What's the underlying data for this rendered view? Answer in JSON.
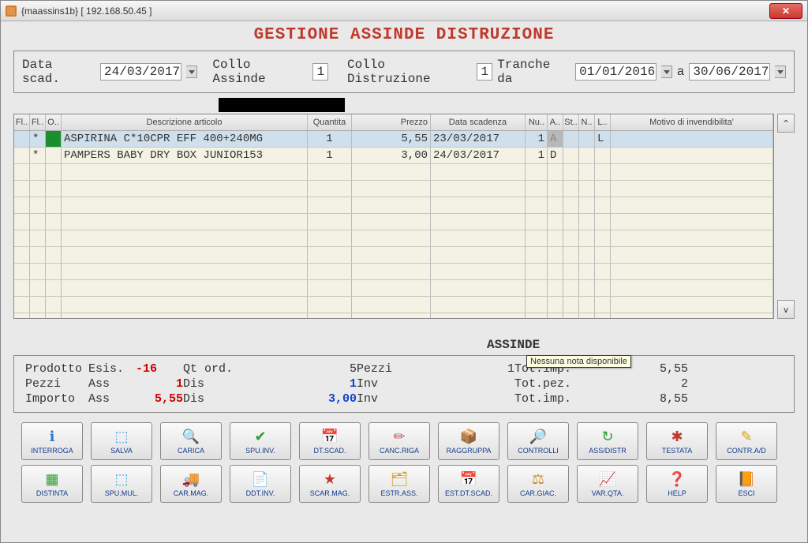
{
  "window": {
    "title": "{maassins1b} [ 192.168.50.45 ]"
  },
  "main_title": "GESTIONE ASSINDE DISTRUZIONE",
  "params": {
    "data_scad_label": "Data scad.",
    "data_scad_value": "24/03/2017",
    "collo_assinde_label": "Collo Assinde",
    "collo_assinde_value": "1",
    "collo_distruzione_label": "Collo Distruzione",
    "collo_distruzione_value": "1",
    "tranche_label": "Tranche da",
    "tranche_from": "01/01/2016",
    "tranche_a": "a",
    "tranche_to": "30/06/2017"
  },
  "grid": {
    "headers": {
      "fla": "Fl..",
      "flb": "Fl..",
      "o": "O..",
      "desc": "Descrizione articolo",
      "qta": "Quantita",
      "prezzo": "Prezzo",
      "scad": "Data scadenza",
      "nu": "Nu..",
      "a": "A..",
      "st": "St..",
      "n": "N..",
      "l": "L..",
      "mot": "Motivo di invendibilita'"
    },
    "rows": [
      {
        "selected": true,
        "flb": "*",
        "desc": "ASPIRINA C*10CPR EFF 400+240MG",
        "qta": "1",
        "prezzo": "5,55",
        "scad": "23/03/2017",
        "nu": "1",
        "a": "A",
        "l": "L"
      },
      {
        "selected": false,
        "flb": "*",
        "desc": "PAMPERS BABY DRY BOX JUNIOR153",
        "qta": "1",
        "prezzo": "3,00",
        "scad": "24/03/2017",
        "nu": "1",
        "a": "D"
      }
    ],
    "scroll_up": "^",
    "scroll_down": "v"
  },
  "section_label": "ASSINDE",
  "hint": "Nessuna nota disponibile",
  "summary": {
    "r1": {
      "prodotto": "Prodotto",
      "esis": "Esis.",
      "esis_val": "-16",
      "qtord": "Qt ord.",
      "qtord_val": "5",
      "pezzi": "Pezzi",
      "pezzi_val": "1",
      "totimp": "Tot.imp.",
      "totimp_val": "5,55"
    },
    "r2": {
      "pezzi": "Pezzi",
      "ass": "Ass",
      "ass_val": "1",
      "dis": "Dis",
      "dis_val": "1",
      "inv": "Inv",
      "totpez": "Tot.pez.",
      "totpez_val": "2"
    },
    "r3": {
      "importo": "Importo",
      "ass": "Ass",
      "ass_val": "5,55",
      "dis": "Dis",
      "dis_val": "3,00",
      "inv": "Inv",
      "totimp": "Tot.imp.",
      "totimp_val": "8,55"
    }
  },
  "toolbar": {
    "row1": [
      {
        "label": "INTERROGA",
        "icon": "ℹ",
        "cls": "ic-info",
        "name": "interroga-button"
      },
      {
        "label": "SALVA",
        "icon": "⬚",
        "cls": "ic-save",
        "name": "salva-button"
      },
      {
        "label": "CARICA",
        "icon": "🔍",
        "cls": "ic-search",
        "name": "carica-button"
      },
      {
        "label": "SPU.INV.",
        "icon": "✔",
        "cls": "ic-ok",
        "name": "spu-inv-button"
      },
      {
        "label": "DT.SCAD.",
        "icon": "📅",
        "cls": "ic-cal",
        "name": "dt-scad-button"
      },
      {
        "label": "CANC.RIGA",
        "icon": "✏",
        "cls": "ic-eraser",
        "name": "canc-riga-button"
      },
      {
        "label": "RAGGRUPPA",
        "icon": "📦",
        "cls": "ic-box",
        "name": "raggruppa-button"
      },
      {
        "label": "CONTROLLI",
        "icon": "🔎",
        "cls": "ic-search2",
        "name": "controlli-button"
      },
      {
        "label": "ASS/DISTR",
        "icon": "↻",
        "cls": "ic-swap",
        "name": "ass-distr-button"
      },
      {
        "label": "TESTATA",
        "icon": "✱",
        "cls": "ic-star",
        "name": "testata-button"
      },
      {
        "label": "CONTR.A/D",
        "icon": "✎",
        "cls": "ic-pencil",
        "name": "contr-ad-button"
      }
    ],
    "row2": [
      {
        "label": "DISTINTA",
        "icon": "▦",
        "cls": "ic-grid",
        "name": "distinta-button"
      },
      {
        "label": "SPU.MUL.",
        "icon": "⬚",
        "cls": "ic-votes",
        "name": "spu-mul-button"
      },
      {
        "label": "CAR.MAG.",
        "icon": "🚚",
        "cls": "ic-car",
        "name": "car-mag-button"
      },
      {
        "label": "DDT.INV.",
        "icon": "📄",
        "cls": "ic-page",
        "name": "ddt-inv-button"
      },
      {
        "label": "SCAR.MAG.",
        "icon": "★",
        "cls": "ic-redstar",
        "name": "scar-mag-button"
      },
      {
        "label": "ESTR.ASS.",
        "icon": "🗂",
        "cls": "ic-card",
        "name": "estr-ass-button"
      },
      {
        "label": "EST.DT.SCAD.",
        "icon": "📅",
        "cls": "ic-cal2",
        "name": "est-dt-scad-button"
      },
      {
        "label": "CAR.GIAC.",
        "icon": "⚖",
        "cls": "ic-scale",
        "name": "car-giac-button"
      },
      {
        "label": "VAR.QTA.",
        "icon": "📈",
        "cls": "ic-chart",
        "name": "var-qta-button"
      },
      {
        "label": "HELP",
        "icon": "❓",
        "cls": "ic-help",
        "name": "help-button"
      },
      {
        "label": "ESCI",
        "icon": "📙",
        "cls": "ic-door",
        "name": "esci-button"
      }
    ]
  }
}
